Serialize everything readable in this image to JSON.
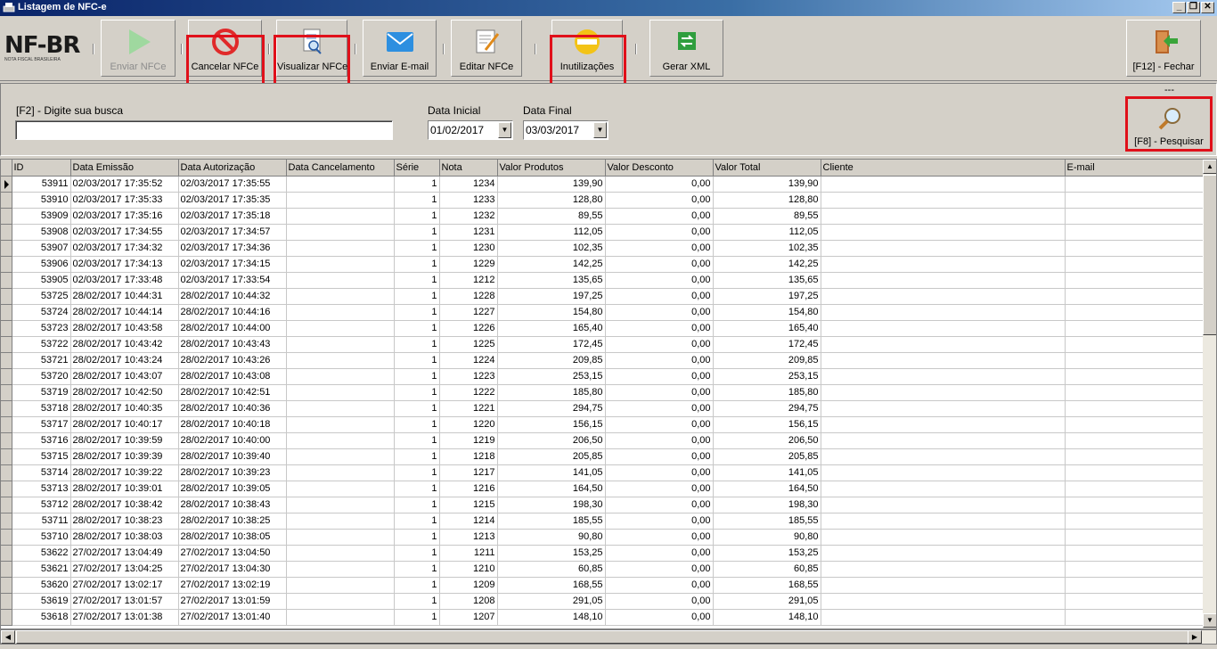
{
  "window": {
    "title": "Listagem de NFC-e"
  },
  "toolbar": {
    "logo_text": "NF-BR",
    "logo_sub": "NOTA FISCAL BRASILEIRA",
    "buttons": [
      {
        "label": "Enviar NFCe",
        "icon": "play-icon",
        "enabled": false
      },
      {
        "label": "Cancelar NFCe",
        "icon": "cancel-icon",
        "enabled": true,
        "highlighted": true
      },
      {
        "label": "Visualizar NFCe",
        "icon": "view-document-icon",
        "enabled": true,
        "highlighted": true
      },
      {
        "label": "Enviar E-mail",
        "icon": "envelope-icon",
        "enabled": true
      },
      {
        "label": "Editar NFCe",
        "icon": "edit-document-icon",
        "enabled": true
      },
      {
        "label": "Inutilizações",
        "icon": "no-entry-icon",
        "enabled": true,
        "highlighted": true
      },
      {
        "label": "Gerar XML",
        "icon": "xml-exchange-icon",
        "enabled": true
      },
      {
        "label": "[F12] - Fechar",
        "icon": "exit-door-icon",
        "enabled": true
      }
    ]
  },
  "search": {
    "label": "[F2] - Digite sua busca",
    "value": "",
    "date_initial_label": "Data Inicial",
    "date_initial": "01/02/2017",
    "date_final_label": "Data Final",
    "date_final": "03/03/2017",
    "status": "---",
    "search_button": "[F8] - Pesquisar"
  },
  "grid": {
    "columns": [
      "ID",
      "Data Emissão",
      "Data Autorização",
      "Data Cancelamento",
      "Série",
      "Nota",
      "Valor Produtos",
      "Valor Desconto",
      "Valor Total",
      "Cliente",
      "E-mail"
    ],
    "rows": [
      [
        "53911",
        "02/03/2017 17:35:52",
        "02/03/2017 17:35:55",
        "",
        "1",
        "1234",
        "139,90",
        "0,00",
        "139,90",
        "",
        ""
      ],
      [
        "53910",
        "02/03/2017 17:35:33",
        "02/03/2017 17:35:35",
        "",
        "1",
        "1233",
        "128,80",
        "0,00",
        "128,80",
        "",
        ""
      ],
      [
        "53909",
        "02/03/2017 17:35:16",
        "02/03/2017 17:35:18",
        "",
        "1",
        "1232",
        "89,55",
        "0,00",
        "89,55",
        "",
        ""
      ],
      [
        "53908",
        "02/03/2017 17:34:55",
        "02/03/2017 17:34:57",
        "",
        "1",
        "1231",
        "112,05",
        "0,00",
        "112,05",
        "",
        ""
      ],
      [
        "53907",
        "02/03/2017 17:34:32",
        "02/03/2017 17:34:36",
        "",
        "1",
        "1230",
        "102,35",
        "0,00",
        "102,35",
        "",
        ""
      ],
      [
        "53906",
        "02/03/2017 17:34:13",
        "02/03/2017 17:34:15",
        "",
        "1",
        "1229",
        "142,25",
        "0,00",
        "142,25",
        "",
        ""
      ],
      [
        "53905",
        "02/03/2017 17:33:48",
        "02/03/2017 17:33:54",
        "",
        "1",
        "1212",
        "135,65",
        "0,00",
        "135,65",
        "",
        ""
      ],
      [
        "53725",
        "28/02/2017 10:44:31",
        "28/02/2017 10:44:32",
        "",
        "1",
        "1228",
        "197,25",
        "0,00",
        "197,25",
        "",
        ""
      ],
      [
        "53724",
        "28/02/2017 10:44:14",
        "28/02/2017 10:44:16",
        "",
        "1",
        "1227",
        "154,80",
        "0,00",
        "154,80",
        "",
        ""
      ],
      [
        "53723",
        "28/02/2017 10:43:58",
        "28/02/2017 10:44:00",
        "",
        "1",
        "1226",
        "165,40",
        "0,00",
        "165,40",
        "",
        ""
      ],
      [
        "53722",
        "28/02/2017 10:43:42",
        "28/02/2017 10:43:43",
        "",
        "1",
        "1225",
        "172,45",
        "0,00",
        "172,45",
        "",
        ""
      ],
      [
        "53721",
        "28/02/2017 10:43:24",
        "28/02/2017 10:43:26",
        "",
        "1",
        "1224",
        "209,85",
        "0,00",
        "209,85",
        "",
        ""
      ],
      [
        "53720",
        "28/02/2017 10:43:07",
        "28/02/2017 10:43:08",
        "",
        "1",
        "1223",
        "253,15",
        "0,00",
        "253,15",
        "",
        ""
      ],
      [
        "53719",
        "28/02/2017 10:42:50",
        "28/02/2017 10:42:51",
        "",
        "1",
        "1222",
        "185,80",
        "0,00",
        "185,80",
        "",
        ""
      ],
      [
        "53718",
        "28/02/2017 10:40:35",
        "28/02/2017 10:40:36",
        "",
        "1",
        "1221",
        "294,75",
        "0,00",
        "294,75",
        "",
        ""
      ],
      [
        "53717",
        "28/02/2017 10:40:17",
        "28/02/2017 10:40:18",
        "",
        "1",
        "1220",
        "156,15",
        "0,00",
        "156,15",
        "",
        ""
      ],
      [
        "53716",
        "28/02/2017 10:39:59",
        "28/02/2017 10:40:00",
        "",
        "1",
        "1219",
        "206,50",
        "0,00",
        "206,50",
        "",
        ""
      ],
      [
        "53715",
        "28/02/2017 10:39:39",
        "28/02/2017 10:39:40",
        "",
        "1",
        "1218",
        "205,85",
        "0,00",
        "205,85",
        "",
        ""
      ],
      [
        "53714",
        "28/02/2017 10:39:22",
        "28/02/2017 10:39:23",
        "",
        "1",
        "1217",
        "141,05",
        "0,00",
        "141,05",
        "",
        ""
      ],
      [
        "53713",
        "28/02/2017 10:39:01",
        "28/02/2017 10:39:05",
        "",
        "1",
        "1216",
        "164,50",
        "0,00",
        "164,50",
        "",
        ""
      ],
      [
        "53712",
        "28/02/2017 10:38:42",
        "28/02/2017 10:38:43",
        "",
        "1",
        "1215",
        "198,30",
        "0,00",
        "198,30",
        "",
        ""
      ],
      [
        "53711",
        "28/02/2017 10:38:23",
        "28/02/2017 10:38:25",
        "",
        "1",
        "1214",
        "185,55",
        "0,00",
        "185,55",
        "",
        ""
      ],
      [
        "53710",
        "28/02/2017 10:38:03",
        "28/02/2017 10:38:05",
        "",
        "1",
        "1213",
        "90,80",
        "0,00",
        "90,80",
        "",
        ""
      ],
      [
        "53622",
        "27/02/2017 13:04:49",
        "27/02/2017 13:04:50",
        "",
        "1",
        "1211",
        "153,25",
        "0,00",
        "153,25",
        "",
        ""
      ],
      [
        "53621",
        "27/02/2017 13:04:25",
        "27/02/2017 13:04:30",
        "",
        "1",
        "1210",
        "60,85",
        "0,00",
        "60,85",
        "",
        ""
      ],
      [
        "53620",
        "27/02/2017 13:02:17",
        "27/02/2017 13:02:19",
        "",
        "1",
        "1209",
        "168,55",
        "0,00",
        "168,55",
        "",
        ""
      ],
      [
        "53619",
        "27/02/2017 13:01:57",
        "27/02/2017 13:01:59",
        "",
        "1",
        "1208",
        "291,05",
        "0,00",
        "291,05",
        "",
        ""
      ],
      [
        "53618",
        "27/02/2017 13:01:38",
        "27/02/2017 13:01:40",
        "",
        "1",
        "1207",
        "148,10",
        "0,00",
        "148,10",
        "",
        ""
      ]
    ]
  },
  "colors": {
    "highlight": "#e0101a",
    "titlebar": "#0a246a",
    "face": "#d4d0c8"
  }
}
